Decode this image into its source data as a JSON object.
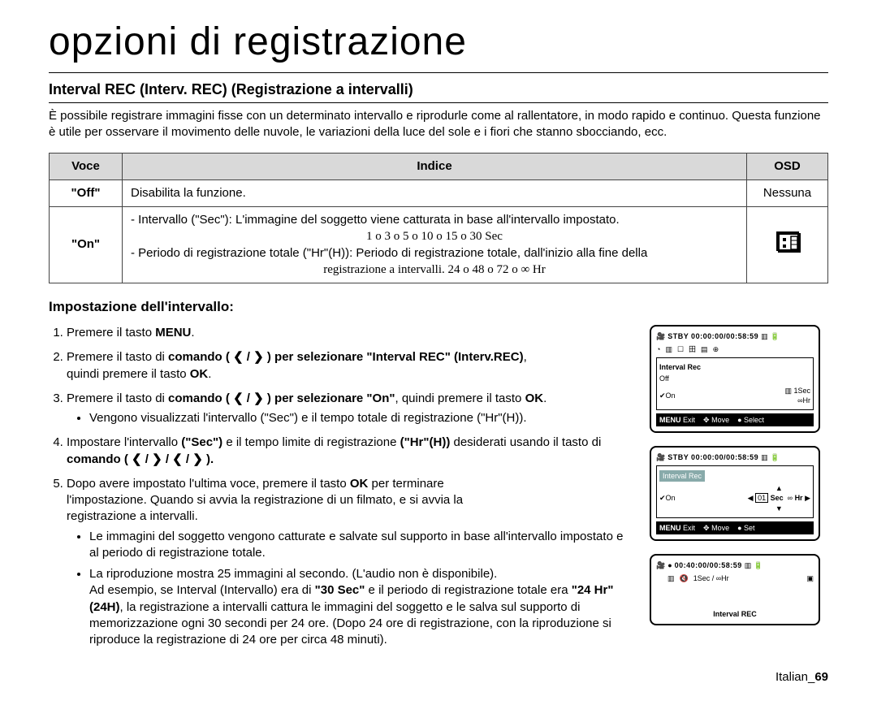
{
  "page": {
    "title": "opzioni di registrazione",
    "section_heading": "Interval REC (Interv. REC) (Registrazione a intervalli)",
    "intro": "È possibile registrare immagini fisse con un determinato intervallo e riprodurle come al rallentatore, in modo rapido e continuo. Questa funzione è utile per osservare il movimento delle nuvole, le variazioni della luce del sole e i fiori che stanno sbocciando, ecc."
  },
  "table": {
    "headers": {
      "voce": "Voce",
      "indice": "Indice",
      "osd": "OSD"
    },
    "rows": {
      "off": {
        "voce": "\"Off\"",
        "indice": "Disabilita la funzione.",
        "osd": "Nessuna"
      },
      "on": {
        "voce": "\"On\"",
        "line1": "- Intervallo (\"Sec\"): L'immagine del soggetto viene catturata in base all'intervallo impostato.",
        "line1_vals": "1 ο 3 ο 5 ο 10 ο 15 ο 30 Sec",
        "line2": "- Periodo di registrazione totale (\"Hr\"(H)): Periodo di registrazione totale, dall'inizio alla fine della",
        "line2_cont": "registrazione a intervalli. 24 ο 48 ο 72 ο ∞ Hr"
      }
    }
  },
  "instructions": {
    "heading": "Impostazione dell'intervallo:",
    "steps": {
      "1": {
        "pre": "Premere il tasto ",
        "b": "MENU",
        "post": "."
      },
      "2": {
        "pre": "Premere il tasto di ",
        "b1": "comando",
        "mid": " ( ❮ / ❯ ) per selezionare ",
        "b2": "\"Interval REC\" (Interv.REC)",
        "post": ",",
        "line2a": "quindi premere il tasto ",
        "line2b": "OK",
        "line2c": "."
      },
      "3": {
        "pre": "Premere il tasto di ",
        "b1": "comando",
        "mid": " ( ❮ / ❯ ) per selezionare ",
        "b2": "\"On\"",
        "post": ", quindi premere il tasto ",
        "b3": "OK",
        "end": ".",
        "bullet": "Vengono visualizzati l'intervallo (\"Sec\") e il tempo totale di registrazione (\"Hr\"(H))."
      },
      "4": {
        "text_a": "Impostare l'intervallo ",
        "text_b": "(\"Sec\")",
        "text_c": " e il tempo limite di registrazione ",
        "text_d": "(\"Hr\"(H))",
        "text_e": " desiderati usando il tasto di ",
        "text_f": "comando",
        "text_g": " ( ❮ / ❯ / ❮ / ❯ )."
      },
      "5": {
        "line1a": "Dopo avere impostato l'ultima voce, premere il tasto  ",
        "line1b": "OK",
        "line1c": " per terminare",
        "line2": "l'impostazione. Quando si avvia la registrazione di un filmato, e si avvia la",
        "line3": "registrazione a intervalli.",
        "b1": "Le immagini del soggetto vengono catturate e salvate sul supporto in base all'intervallo impostato e al periodo di registrazione totale.",
        "b2a": "La riproduzione mostra 25 immagini al secondo. (L'audio non è disponibile).",
        "b2b_pre": "Ad esempio, se Interval (Intervallo) era di ",
        "b2b_b1": "\"30 Sec\"",
        "b2b_mid": " e il periodo di registrazione totale era ",
        "b2b_b2": "\"24 Hr\"(24H)",
        "b2c": ", la registrazione a intervalli cattura le immagini del soggetto e le salva sul supporto di memorizzazione ogni 30 secondi per 24 ore. (Dopo 24 ore di registrazione, con la riproduzione si riproduce la registrazione di 24 ore per circa 48 minuti)."
      }
    }
  },
  "screens": {
    "s1": {
      "status": "STBY 00:00:00/00:58:59",
      "menu_title": "Interval Rec",
      "off": "Off",
      "on": "On",
      "right1": "1Sec",
      "right2": "∞Hr",
      "menu": "MENU",
      "exit": "Exit",
      "move": "Move",
      "select": "Select"
    },
    "s2": {
      "status": "STBY 00:00:00/00:58:59",
      "menu_title": "Interval Rec",
      "on": "On",
      "sec_val": "01",
      "sec_lbl": "Sec",
      "hr_sym": "∞",
      "hr_lbl": "Hr",
      "menu": "MENU",
      "exit": "Exit",
      "move": "Move",
      "set": "Set"
    },
    "s3": {
      "status": "00:40:00/00:58:59",
      "sub": "1Sec / ∞Hr",
      "label": "Interval REC"
    }
  },
  "footer": {
    "lang": "Italian",
    "sep": "_",
    "page": "69"
  }
}
